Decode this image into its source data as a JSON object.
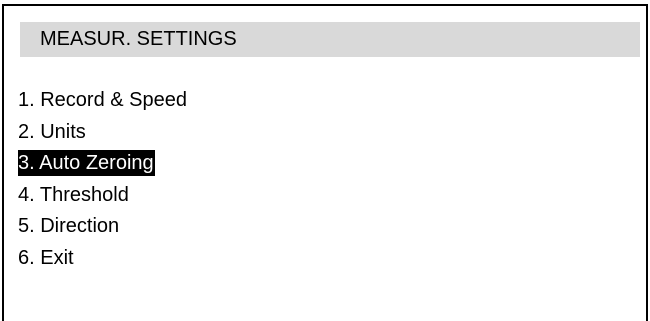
{
  "screen": {
    "title": "MEASUR. SETTINGS",
    "title_bg": "#d9d9d9",
    "highlight_bg": "#000000",
    "highlight_fg": "#ffffff"
  },
  "menu": {
    "selected_index": 2,
    "items": [
      {
        "label": "1. Record & Speed"
      },
      {
        "label": "2. Units"
      },
      {
        "label": "3. Auto Zeroing"
      },
      {
        "label": "4. Threshold"
      },
      {
        "label": "5. Direction"
      },
      {
        "label": "6. Exit"
      }
    ]
  }
}
